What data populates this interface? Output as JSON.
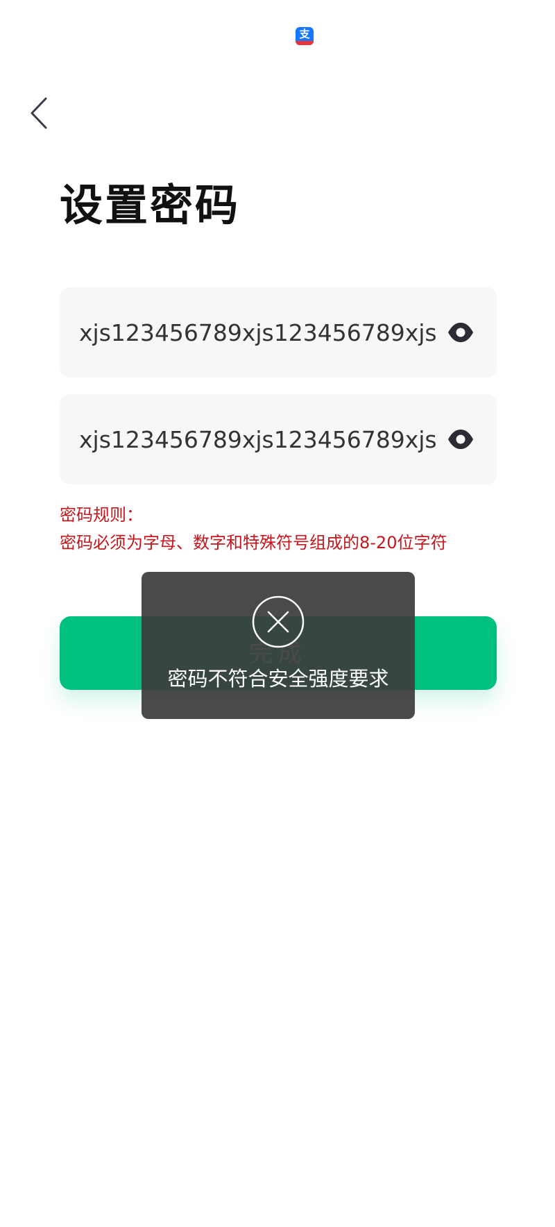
{
  "status_bar": {
    "app_icon": "alipay-icon",
    "app_icon_glyph": "支",
    "app_icon_color": "#1677ff"
  },
  "header": {
    "back_icon": "chevron-left-icon",
    "title": "设置密码"
  },
  "form": {
    "password": {
      "value": "xjs123456789xjs123456789xjs",
      "icon": "eye-icon"
    },
    "confirm_password": {
      "value": "xjs123456789xjs123456789xjs",
      "icon": "eye-icon"
    }
  },
  "rules": {
    "heading": "密码规则：",
    "text": "密码必须为字母、数字和特殊符号组成的8-20位字符",
    "color": "#c4161c"
  },
  "actions": {
    "submit_label": "完成",
    "submit_color": "#00c07f"
  },
  "toast": {
    "icon": "close-circle-icon",
    "message": "密码不符合安全强度要求"
  }
}
